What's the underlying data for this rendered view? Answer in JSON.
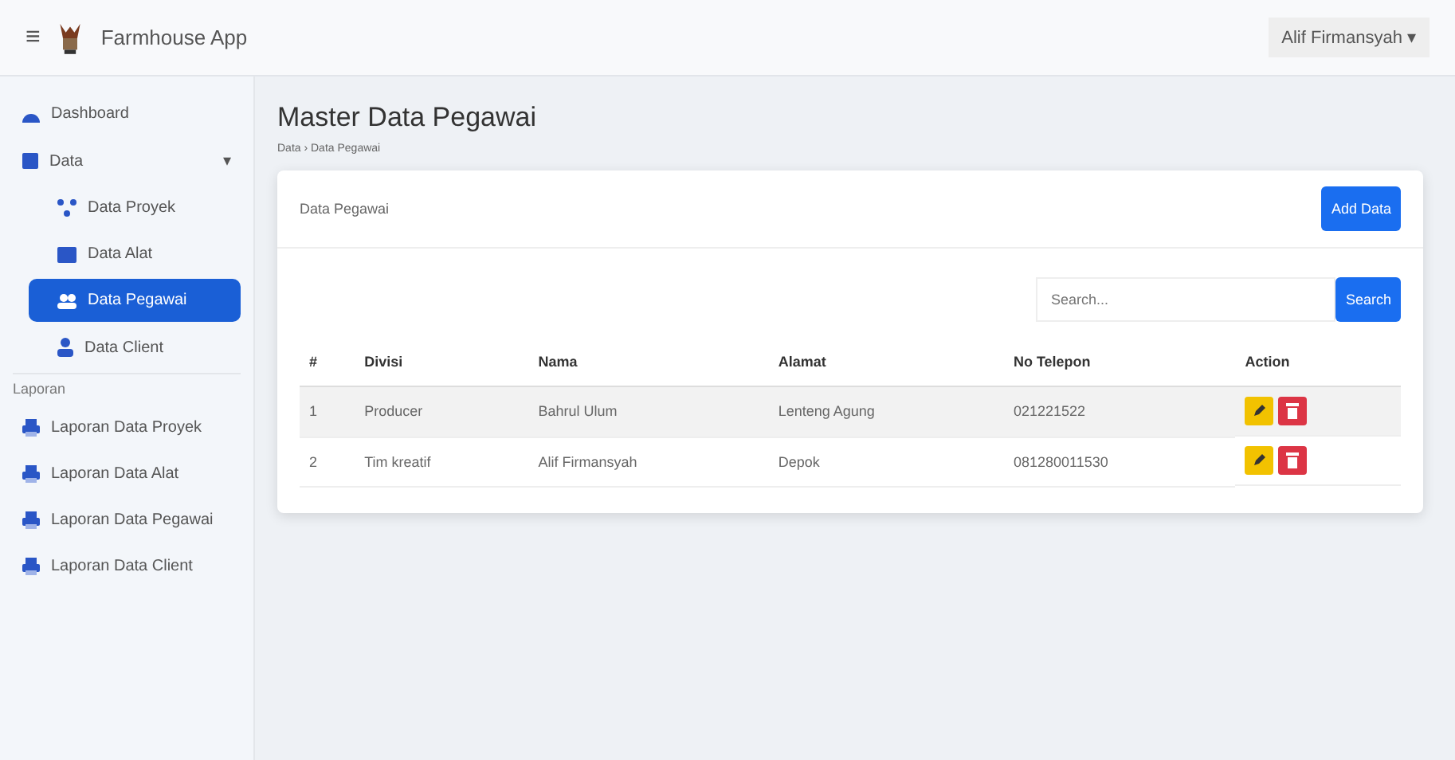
{
  "navbar": {
    "menu_glyph": "≡",
    "brand": "Farmhouse App",
    "user": "Alif Firmansyah",
    "user_caret": "▾"
  },
  "sidebar": {
    "items": [
      {
        "label": "Dashboard",
        "kind": "link",
        "selected": false
      },
      {
        "label": "Data",
        "kind": "group",
        "expanded": true,
        "caret": "▾",
        "selected": false,
        "children": [
          {
            "label": "Data Proyek",
            "kind": "network",
            "selected": false
          },
          {
            "label": "Data Alat",
            "kind": "box",
            "selected": false
          },
          {
            "label": "Data Pegawai",
            "kind": "users",
            "selected": true
          },
          {
            "label": "Data Client",
            "kind": "user",
            "selected": false
          }
        ]
      },
      {
        "label": "Laporan",
        "kind": "heading"
      },
      {
        "label": "Laporan Data Proyek",
        "kind": "report",
        "selected": false
      },
      {
        "label": "Laporan Data Alat",
        "kind": "report",
        "selected": false
      },
      {
        "label": "Laporan Data Pegawai",
        "kind": "report",
        "selected": false
      },
      {
        "label": "Laporan Data Client",
        "kind": "report",
        "selected": false
      }
    ]
  },
  "page": {
    "title": "Master Data Pegawai",
    "breadcrumb": "Data › Data Pegawai"
  },
  "card": {
    "title": "Data Pegawai",
    "add_button": "Add Data",
    "search": {
      "placeholder": "Search..."
    },
    "search_button": "Search",
    "table": {
      "columns": [
        "#",
        "Divisi",
        "Nama",
        "Alamat",
        "No Telepon",
        "Action"
      ],
      "rows": [
        {
          "cells": [
            "1",
            "Producer",
            "Bahrul Ulum",
            "Lenteng Agung",
            "021221522"
          ]
        },
        {
          "cells": [
            "2",
            "Tim kreatif",
            "Alif Firmansyah",
            "Depok",
            "081280011530"
          ]
        }
      ]
    }
  }
}
